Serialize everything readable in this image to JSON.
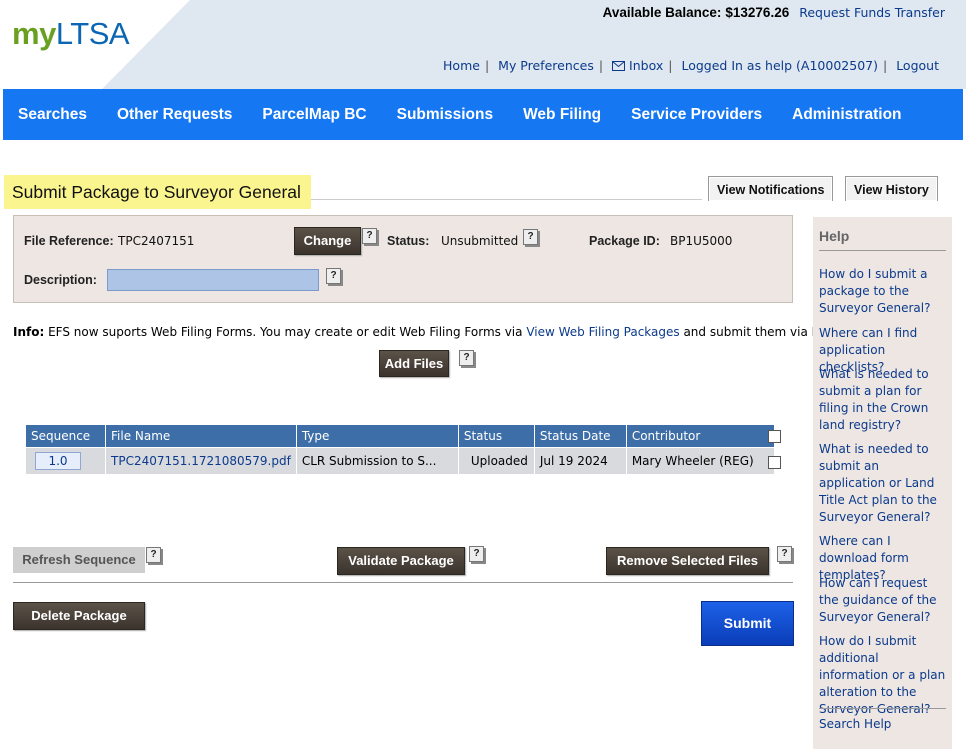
{
  "header": {
    "logo_my": "my",
    "logo_ltsa": "LTSA",
    "balance_label": "Available Balance:",
    "balance_value": "$13276.26",
    "request_funds": "Request Funds Transfer",
    "links": {
      "home": "Home",
      "preferences": "My Preferences",
      "inbox": "Inbox",
      "logged_in": "Logged In as help (A10002507)",
      "logout": "Logout"
    }
  },
  "nav": [
    "Searches",
    "Other Requests",
    "ParcelMap BC",
    "Submissions",
    "Web Filing",
    "Service Providers",
    "Administration"
  ],
  "page": {
    "title": "Submit Package to Surveyor General",
    "view_notifications": "View Notifications",
    "view_history": "View History"
  },
  "form": {
    "file_ref_label": "File Reference:",
    "file_ref_value": "TPC2407151",
    "change_label": "Change",
    "status_label": "Status:",
    "status_value": "Unsubmitted",
    "package_id_label": "Package ID:",
    "package_id_value": "BP1U5000",
    "description_label": "Description:",
    "description_value": "",
    "help_mark": "?"
  },
  "info": {
    "label": "Info:",
    "text_before": " EFS now suports Web Filing Forms. You may create or edit Web Filing Forms via ",
    "link": "View Web Filing Packages",
    "text_after": " and submit them via EFS."
  },
  "add_files": "Add Files",
  "table": {
    "headers": [
      "Sequence",
      "File Name",
      "Type",
      "Status",
      "Status Date",
      "Contributor"
    ],
    "rows": [
      {
        "sequence": "1.0",
        "file_name": "TPC2407151.1721080579.pdf",
        "type": "CLR Submission to S...",
        "status": "Uploaded",
        "status_date": "Jul 19 2024",
        "contributor": "Mary Wheeler (REG)"
      }
    ]
  },
  "actions": {
    "refresh": "Refresh Sequence",
    "validate": "Validate Package",
    "remove": "Remove Selected Files",
    "delete": "Delete Package",
    "submit": "Submit"
  },
  "help": {
    "title": "Help",
    "links": [
      "How do I submit a package to the Surveyor General?",
      "Where can I find application checklists?",
      "What is needed to submit a plan for filing in the Crown land registry?",
      "What is needed to submit an application or Land Title Act plan to the Surveyor General?",
      "Where can I download form templates?",
      "How can I request the guidance of the Surveyor General?",
      "How do I submit additional information or a plan alteration to the Surveyor General?"
    ],
    "search": "Search Help"
  },
  "colors": {
    "nav_blue": "#1677f2",
    "title_highlight": "#fbf58f",
    "table_header": "#3e6ea7",
    "submit_blue": "#1e62e8"
  }
}
